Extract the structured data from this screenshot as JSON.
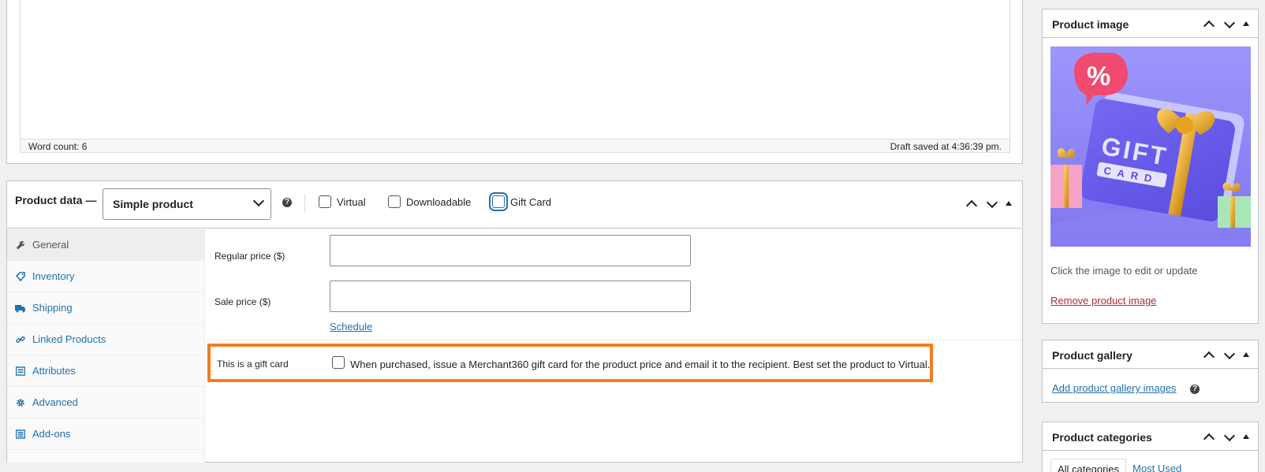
{
  "editor": {
    "word_count": "Word count: 6",
    "draft_saved": "Draft saved at 4:36:39 pm."
  },
  "product_data": {
    "title": "Product data —",
    "type_selected": "Simple product",
    "help_glyph": "?",
    "options": {
      "virtual": "Virtual",
      "downloadable": "Downloadable",
      "gift_card": "Gift Card"
    },
    "tabs": [
      {
        "label": "General",
        "icon": "wrench-icon",
        "active": true
      },
      {
        "label": "Inventory",
        "icon": "tag-icon"
      },
      {
        "label": "Shipping",
        "icon": "truck-icon"
      },
      {
        "label": "Linked Products",
        "icon": "link-icon"
      },
      {
        "label": "Attributes",
        "icon": "list-icon"
      },
      {
        "label": "Advanced",
        "icon": "gear-icon"
      },
      {
        "label": "Add-ons",
        "icon": "list-icon"
      }
    ],
    "general": {
      "regular_price_label": "Regular price ($)",
      "regular_price_value": "",
      "sale_price_label": "Sale price ($)",
      "sale_price_value": "",
      "schedule_link": "Schedule",
      "gift_card_label": "This is a gift card",
      "gift_card_desc": "When purchased, issue a Merchant360 gift card for the product price and email it to the recipient. Best set the product to Virtual."
    },
    "highlight_color": "#f47d20"
  },
  "sidebar": {
    "product_image": {
      "title": "Product image",
      "image_text_main": "GIFT",
      "image_text_sub": "CARD",
      "image_badge": "%",
      "hint": "Click the image to edit or update",
      "remove_link": "Remove product image"
    },
    "product_gallery": {
      "title": "Product gallery",
      "add_link": "Add product gallery images"
    },
    "product_categories": {
      "title": "Product categories",
      "tab_all": "All categories",
      "tab_most_used": "Most Used"
    }
  },
  "colors": {
    "link": "#2271b1",
    "danger": "#b32d2e",
    "focus": "#2271b1"
  }
}
